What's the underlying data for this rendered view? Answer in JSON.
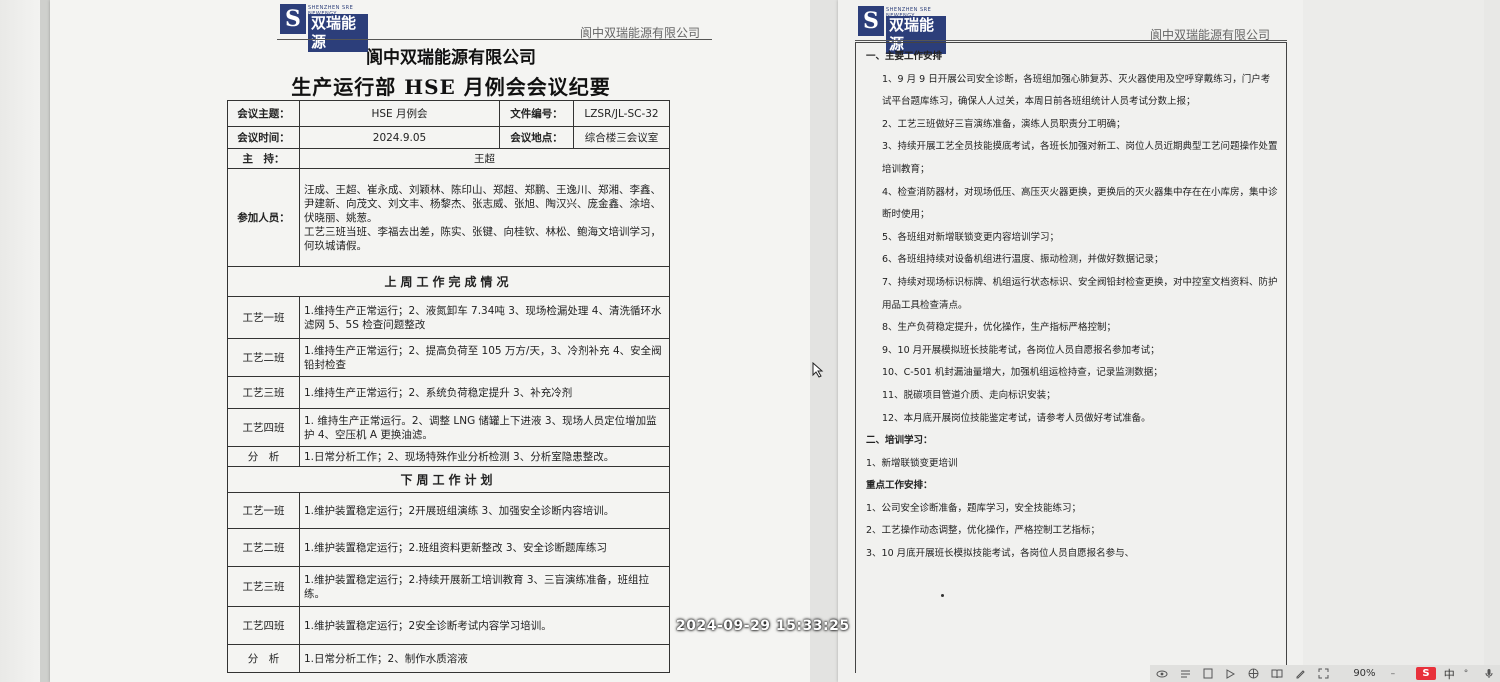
{
  "logo": {
    "mark": "S",
    "en": "SHENZHEN SRE NEWENGY",
    "cn": "双瑞能源"
  },
  "header_company": "阆中双瑞能源有限公司",
  "title_company": "阆中双瑞能源有限公司",
  "title_doc": "生产运行部 HSE 月例会会议纪要",
  "meta": {
    "subject_label": "会议主题：",
    "subject_value": "HSE 月例会",
    "fileno_label": "文件编号：",
    "fileno_value": "LZSR/JL-SC-32",
    "time_label": "会议时间：",
    "time_value": "2024.9.05",
    "place_label": "会议地点：",
    "place_value": "综合楼三会议室",
    "host_label": "主　持：",
    "host_value": "王超",
    "attendees_label": "参加人员：",
    "attendees_value": "汪成、王超、崔永成、刘颖林、陈印山、郑超、郑鹏、王逸川、郑湘、李鑫、尹建新、向茂文、刘文丰、杨黎杰、张志威、张旭、陶汉兴、庞金鑫、涂培、伏晓丽、姚葱。",
    "attendees_note": "工艺三班当班、李福去出差，陈实、张键、向桂钦、林松、鲍海文培训学习，何玖城请假。"
  },
  "last_week": {
    "header": "上周工作完成情况",
    "rows": [
      {
        "team": "工艺一班",
        "text": "1.维持生产正常运行；2、液氮卸车 7.34吨 3、现场检漏处理 4、清洗循环水滤网 5、5S 检查问题整改"
      },
      {
        "team": "工艺二班",
        "text": "1.维持生产正常运行；2、提高负荷至 105 万方/天，3、冷剂补充 4、安全阀铅封检查"
      },
      {
        "team": "工艺三班",
        "text": "1.维持生产正常运行；2、系统负荷稳定提升 3、补充冷剂"
      },
      {
        "team": "工艺四班",
        "text": "1. 维持生产正常运行。2、调整 LNG 储罐上下进液 3、现场人员定位增加监护 4、空压机 A 更换油滤。"
      },
      {
        "team": "分　析",
        "text": "1.日常分析工作；2、现场特殊作业分析检测 3、分析室隐患整改。"
      }
    ]
  },
  "next_week": {
    "header": "下周工作计划",
    "rows": [
      {
        "team": "工艺一班",
        "text": "1.维护装置稳定运行；2开展班组演练 3、加强安全诊断内容培训。"
      },
      {
        "team": "工艺二班",
        "text": "1.维护装置稳定运行；2.班组资料更新整改 3、安全诊断题库练习"
      },
      {
        "team": "工艺三班",
        "text": "1.维护装置稳定运行；2.持续开展新工培训教育 3、三盲演练准备，班组拉练。"
      },
      {
        "team": "工艺四班",
        "text": "1.维护装置稳定运行；2安全诊断考试内容学习培训。"
      },
      {
        "team": "分　析",
        "text": "1.日常分析工作；2、制作水质溶液"
      }
    ]
  },
  "right_page": {
    "section1": "一、主要工作安排",
    "items": [
      "1、9 月 9 日开展公司安全诊断，各班组加强心肺复苏、灭火器使用及空呼穿戴练习，门户考试平台题库练习，确保人人过关，本周日前各班组统计人员考试分数上报；",
      "2、工艺三班做好三盲演练准备，演练人员职责分工明确；",
      "3、持续开展工艺全员技能摸底考试，各班长加强对新工、岗位人员近期典型工艺问题操作处置培训教育；",
      "4、检查消防器材，对现场低压、高压灭火器更换，更换后的灭火器集中存在在小库房，集中诊断时使用；",
      "5、各班组对新增联锁变更内容培训学习；",
      "6、各班组持续对设备机组进行温度、振动检测，并做好数据记录；",
      "7、持续对现场标识标牌、机组运行状态标识、安全阀铅封检查更换，对中控室文档资料、防护用品工具检查清点。",
      "8、生产负荷稳定提升，优化操作，生产指标严格控制；",
      "9、10 月开展模拟班长技能考试，各岗位人员自愿报名参加考试；",
      "10、C-501 机封漏油量增大，加强机组运检持查，记录监测数据；",
      "11、脱碳项目管道介质、走向标识安装；",
      "12、本月底开展岗位技能鉴定考试，请参考人员做好考试准备。"
    ],
    "section2": "二、培训学习：",
    "training": "1、新增联锁变更培训",
    "section3": "重点工作安排：",
    "focus": [
      "1、公司安全诊断准备，题库学习，安全技能练习；",
      "2、工艺操作动态调整，优化操作，严格控制工艺指标；",
      "3、10 月底开展班长模拟技能考试，各岗位人员自愿报名参与、"
    ]
  },
  "timestamp": "2024-09-29 15:33:25",
  "statusbar": {
    "zoom": "90%",
    "ime": "中",
    "s_logo": "S"
  },
  "colors": {
    "logo_blue": "#2c3e7a",
    "s_logo_red": "#e8313b"
  }
}
